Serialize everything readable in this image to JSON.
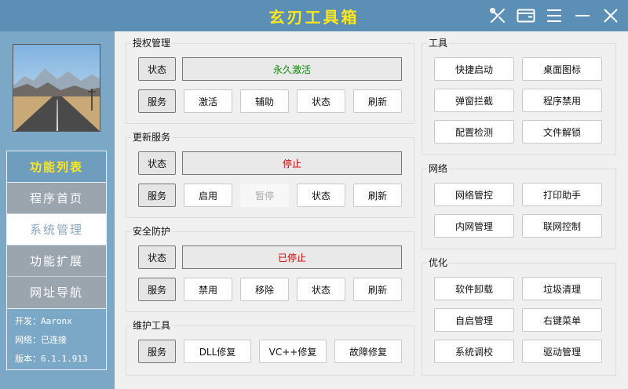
{
  "window": {
    "title": "玄刃工具箱"
  },
  "sidebar": {
    "menu_title": "功能列表",
    "items": [
      {
        "label": "程序首页",
        "active": false
      },
      {
        "label": "系统管理",
        "active": true
      },
      {
        "label": "功能扩展",
        "active": false
      },
      {
        "label": "网址导航",
        "active": false
      }
    ],
    "info": {
      "developer": "开发：Aaronx",
      "network": "网络：已连接",
      "version": "版本：6.1.1.913"
    }
  },
  "license": {
    "label": "授权管理",
    "status_btn": "状态",
    "status_value": "永久激活",
    "status_color": "#0c8a0c",
    "service_btn": "服务",
    "actions": [
      "激活",
      "辅助",
      "状态",
      "刷新"
    ]
  },
  "update": {
    "label": "更新服务",
    "status_btn": "状态",
    "status_value": "停止",
    "status_color": "#d40000",
    "service_btn": "服务",
    "actions": [
      "启用",
      "暂停",
      "状态",
      "刷新"
    ]
  },
  "security": {
    "label": "安全防护",
    "status_btn": "状态",
    "status_value": "已停止",
    "status_color": "#d40000",
    "service_btn": "服务",
    "actions": [
      "禁用",
      "移除",
      "状态",
      "刷新"
    ]
  },
  "maintenance": {
    "label": "维护工具",
    "service_btn": "服务",
    "actions": [
      "DLL修复",
      "VC++修复",
      "故障修复"
    ]
  },
  "tools": {
    "label": "工具",
    "buttons": [
      "快捷启动",
      "桌面图标",
      "弹窗拦截",
      "程序禁用",
      "配置检测",
      "文件解锁"
    ]
  },
  "network": {
    "label": "网络",
    "buttons": [
      "网络管控",
      "打印助手",
      "内网管理",
      "联网控制"
    ]
  },
  "optimize": {
    "label": "优化",
    "buttons": [
      "软件卸载",
      "垃圾清理",
      "自启管理",
      "右键菜单",
      "系统调校",
      "驱动管理"
    ]
  },
  "icons": {
    "settings": "tools-icon",
    "skin": "window-icon",
    "menu": "menu-icon",
    "minimize": "minimize-icon",
    "close": "close-icon"
  }
}
